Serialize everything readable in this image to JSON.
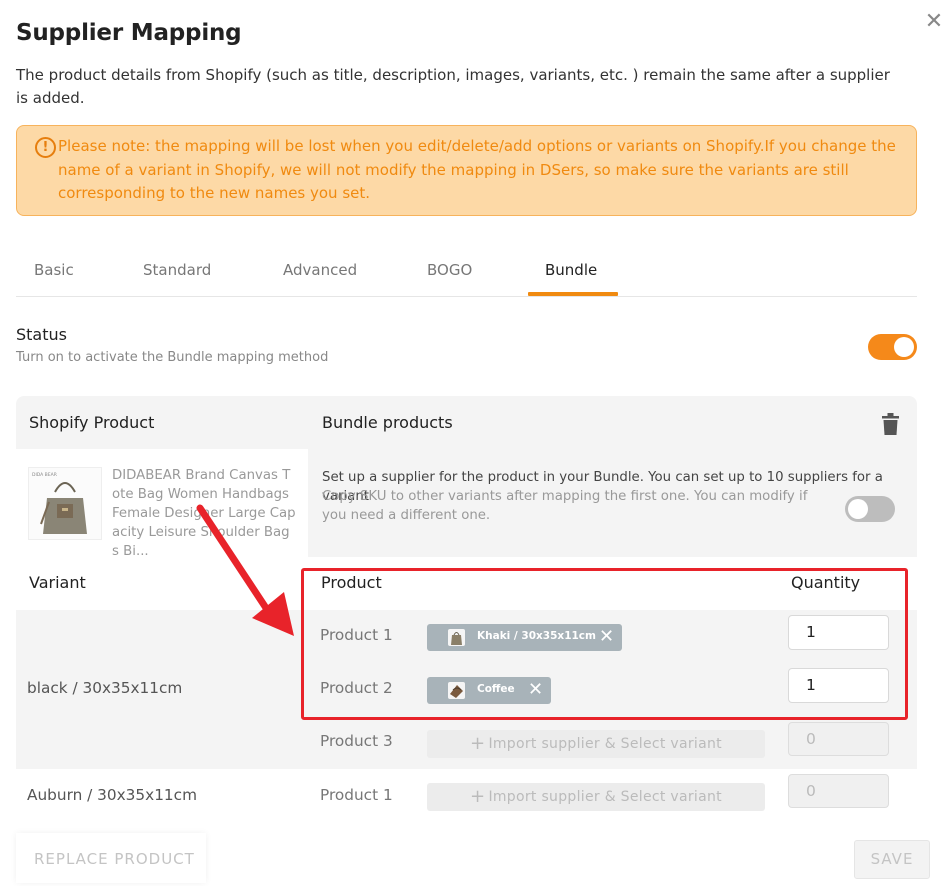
{
  "dialog": {
    "close_icon": "close-icon",
    "title": "Supplier Mapping",
    "description": "The product details from Shopify (such as title, description, images, variants, etc. ) remain the same after a supplier is added.",
    "notice": "Please note: the mapping will be lost when you edit/delete/add options or variants on Shopify.If you change the name of a variant in Shopify, we will not modify the mapping in DSers, so make sure the variants are still corresponding to the new names you set.",
    "notice_icon": "!"
  },
  "tabs": [
    {
      "label": "Basic",
      "active": false
    },
    {
      "label": "Standard",
      "active": false
    },
    {
      "label": "Advanced",
      "active": false
    },
    {
      "label": "BOGO",
      "active": false
    },
    {
      "label": "Bundle",
      "active": true
    }
  ],
  "status": {
    "label": "Status",
    "sub": "Turn on to activate the Bundle mapping method",
    "enabled": true
  },
  "panel": {
    "shopify_product_header": "Shopify Product",
    "bundle_products_header": "Bundle products",
    "product_title": "DIDABEAR Brand Canvas Tote Bag Women Handbags Female Designer Large Capacity Leisure Shoulder Bags Bi...",
    "thumb_brand": "DIDA BEAR",
    "bundle_info": "Set up a supplier for the product in your Bundle. You can set up to 10 suppliers for a variant",
    "copy_sku_info": "Copy SKU to other variants after mapping the first one. You can modify if you need a different one.",
    "copy_sku_enabled": false,
    "variant_header": "Variant",
    "product_header": "Product",
    "quantity_header": "Quantity"
  },
  "variants": [
    {
      "name": "black / 30x35x11cm",
      "rows": [
        {
          "label": "Product 1",
          "chip": "Khaki / 30x35x11cm",
          "quantity": "1"
        },
        {
          "label": "Product 2",
          "chip": "Coffee",
          "quantity": "1"
        },
        {
          "label": "Product 3",
          "import": "Import supplier & Select variant",
          "quantity_placeholder": "0"
        }
      ]
    },
    {
      "name": "Auburn / 30x35x11cm",
      "rows": [
        {
          "label": "Product 1",
          "import": "Import supplier & Select variant",
          "quantity_placeholder": "0"
        }
      ]
    }
  ],
  "footer": {
    "replace_label": "REPLACE PRODUCT",
    "save_label": "SAVE"
  },
  "colors": {
    "accent": "#f5891a",
    "notice_bg": "#fdd9a6",
    "notice_text": "#f08a10",
    "annotation_red": "#e8232a",
    "chip_bg": "#a8b3b9"
  }
}
